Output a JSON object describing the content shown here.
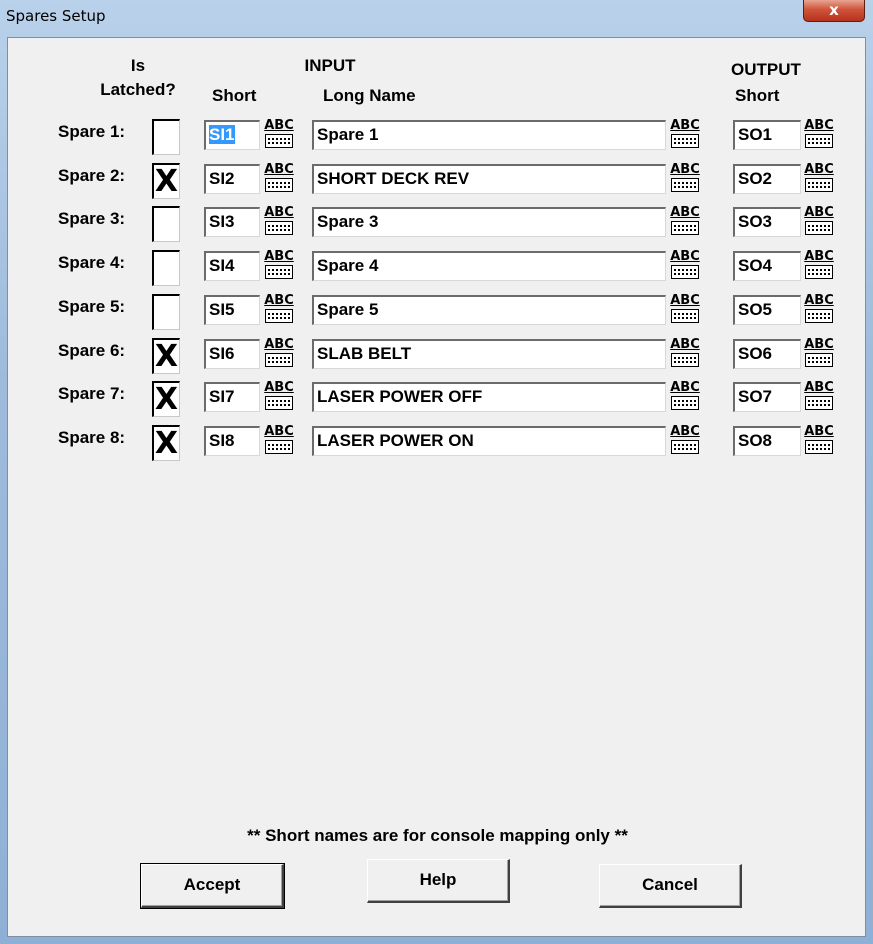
{
  "window": {
    "title": "Spares Setup",
    "close_glyph": "x"
  },
  "headers": {
    "is": "Is",
    "latched": "Latched?",
    "input": "INPUT",
    "input_short": "Short",
    "long_name": "Long Name",
    "output": "OUTPUT",
    "output_short": "Short"
  },
  "abc_label": "ABC",
  "rows": [
    {
      "label": "Spare 1:",
      "latched": false,
      "mark": "",
      "input_short": "SI1",
      "long_name": "Spare 1",
      "output_short": "SO1"
    },
    {
      "label": "Spare 2:",
      "latched": true,
      "mark": "X",
      "input_short": "SI2",
      "long_name": "SHORT DECK REV",
      "output_short": "SO2"
    },
    {
      "label": "Spare 3:",
      "latched": false,
      "mark": "",
      "input_short": "SI3",
      "long_name": "Spare 3",
      "output_short": "SO3"
    },
    {
      "label": "Spare 4:",
      "latched": false,
      "mark": "",
      "input_short": "SI4",
      "long_name": "Spare 4",
      "output_short": "SO4"
    },
    {
      "label": "Spare 5:",
      "latched": false,
      "mark": "",
      "input_short": "SI5",
      "long_name": "Spare 5",
      "output_short": "SO5"
    },
    {
      "label": "Spare 6:",
      "latched": true,
      "mark": "X",
      "input_short": "SI6",
      "long_name": "SLAB BELT",
      "output_short": "SO6"
    },
    {
      "label": "Spare 7:",
      "latched": true,
      "mark": "X",
      "input_short": "SI7",
      "long_name": "LASER POWER OFF",
      "output_short": "SO7"
    },
    {
      "label": "Spare 8:",
      "latched": true,
      "mark": "X",
      "input_short": "SI8",
      "long_name": "LASER POWER ON",
      "output_short": "SO8"
    }
  ],
  "note": "** Short names are for console mapping only **",
  "buttons": {
    "accept": "Accept",
    "help": "Help",
    "cancel": "Cancel"
  },
  "colors": {
    "selection": "#3399ff",
    "dialog_bg": "#f0f0f0",
    "close_button": "#c7432a"
  },
  "icons": {
    "abc": "keyboard-abc-icon",
    "close": "close-icon"
  }
}
